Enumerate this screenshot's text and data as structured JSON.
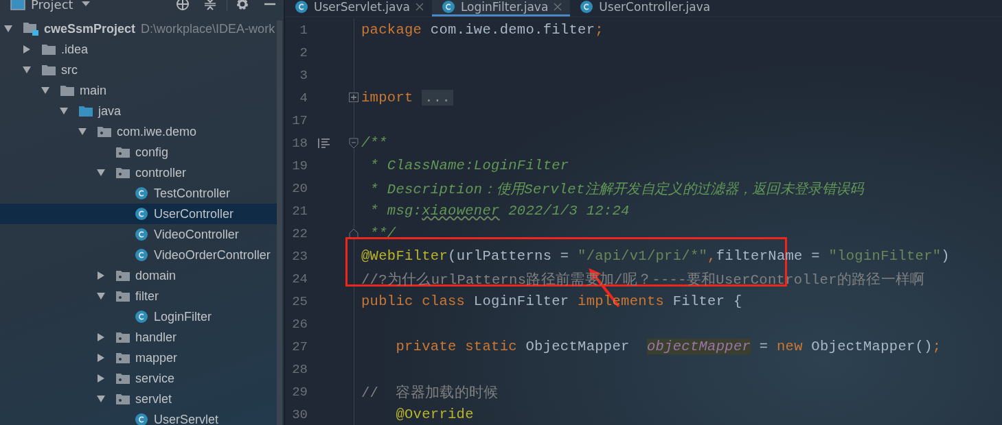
{
  "project_panel": {
    "title": "Project"
  },
  "tree": [
    {
      "label": "cweSsmProject",
      "path": "D:\\workplace\\IDEA-work",
      "kind": "module",
      "expanded": true,
      "selected": false,
      "children": [
        {
          "label": ".idea",
          "kind": "folder",
          "expanded": false,
          "selected": false
        },
        {
          "label": "src",
          "kind": "folder",
          "expanded": true,
          "selected": false,
          "children": [
            {
              "label": "main",
              "kind": "folder",
              "expanded": true,
              "selected": false,
              "children": [
                {
                  "label": "java",
                  "kind": "source",
                  "expanded": true,
                  "selected": false,
                  "children": [
                    {
                      "label": "com.iwe.demo",
                      "kind": "package",
                      "expanded": true,
                      "selected": false,
                      "children": [
                        {
                          "label": "config",
                          "kind": "package",
                          "selected": false
                        },
                        {
                          "label": "controller",
                          "kind": "package",
                          "expanded": true,
                          "selected": false,
                          "children": [
                            {
                              "label": "TestController",
                              "kind": "class",
                              "selected": false
                            },
                            {
                              "label": "UserController",
                              "kind": "class",
                              "selected": true
                            },
                            {
                              "label": "VideoController",
                              "kind": "class",
                              "selected": false
                            },
                            {
                              "label": "VideoOrderController",
                              "kind": "class",
                              "selected": false
                            }
                          ]
                        },
                        {
                          "label": "domain",
                          "kind": "package",
                          "expanded": false,
                          "selected": false
                        },
                        {
                          "label": "filter",
                          "kind": "package",
                          "expanded": true,
                          "selected": false,
                          "children": [
                            {
                              "label": "LoginFilter",
                              "kind": "class",
                              "selected": false
                            }
                          ]
                        },
                        {
                          "label": "handler",
                          "kind": "package",
                          "expanded": false,
                          "selected": false
                        },
                        {
                          "label": "mapper",
                          "kind": "package",
                          "expanded": false,
                          "selected": false
                        },
                        {
                          "label": "service",
                          "kind": "package",
                          "expanded": false,
                          "selected": false
                        },
                        {
                          "label": "servlet",
                          "kind": "package",
                          "expanded": true,
                          "selected": false,
                          "children": [
                            {
                              "label": "UserServlet",
                              "kind": "class",
                              "selected": false
                            }
                          ]
                        }
                      ]
                    }
                  ]
                }
              ]
            }
          ]
        }
      ]
    }
  ],
  "tabs": [
    {
      "label": "UserServlet.java",
      "selected": false,
      "closable": true
    },
    {
      "label": "LoginFilter.java",
      "selected": true,
      "closable": true
    },
    {
      "label": "UserController.java",
      "selected": false,
      "closable": false
    }
  ],
  "code": [
    {
      "number": "1",
      "tokens": [
        {
          "kind": "keyword",
          "text": "package "
        },
        {
          "kind": "plain",
          "text": "com.iwe.demo.filter"
        },
        {
          "kind": "keyword",
          "text": ";"
        }
      ]
    },
    {
      "number": "2"
    },
    {
      "number": "3"
    },
    {
      "number": "4",
      "fold": {
        "kind": "collapsed"
      },
      "tokens": [
        {
          "kind": "keyword",
          "text": "import "
        },
        {
          "kind": "folded",
          "text": "..."
        }
      ]
    },
    {
      "number": "17"
    },
    {
      "number": "18",
      "fold": {
        "kind": "start"
      },
      "doc_toggle": true,
      "tokens": [
        {
          "kind": "doc",
          "text": "/**"
        }
      ]
    },
    {
      "number": "19",
      "tokens": [
        {
          "kind": "doc",
          "text": " * ClassName:LoginFilter"
        }
      ]
    },
    {
      "number": "20",
      "tokens": [
        {
          "kind": "doc",
          "text": " * Description：使用Servlet注解开发自定义的过滤器，返回未登录错误码"
        }
      ]
    },
    {
      "number": "21",
      "tokens": [
        {
          "kind": "doc",
          "text": " * msg:"
        },
        {
          "kind": "typo",
          "text": "xiaowener"
        },
        {
          "kind": "doc",
          "text": " 2022/1/3 12:24"
        }
      ]
    },
    {
      "number": "22",
      "fold": {
        "kind": "end"
      },
      "tokens": [
        {
          "kind": "doc",
          "text": " **/"
        }
      ]
    },
    {
      "number": "23",
      "tokens": [
        {
          "kind": "annotation",
          "text": "@WebFilter"
        },
        {
          "kind": "plain",
          "text": "(urlPatterns = "
        },
        {
          "kind": "string",
          "text": "\"/api/v1/pri/*\""
        },
        {
          "kind": "keyword",
          "text": ","
        },
        {
          "kind": "plain",
          "text": "filterName = "
        },
        {
          "kind": "string",
          "text": "\"loginFilter\""
        },
        {
          "kind": "plain",
          "text": ")"
        }
      ]
    },
    {
      "number": "24",
      "tokens": [
        {
          "kind": "comment",
          "text": "//?为什么urlPatterns路径前需要加/呢？----要和UserController的路径一样啊"
        }
      ]
    },
    {
      "number": "25",
      "tokens": [
        {
          "kind": "keyword",
          "text": "public class "
        },
        {
          "kind": "plain",
          "text": "LoginFilter "
        },
        {
          "kind": "keyword",
          "text": "implements "
        },
        {
          "kind": "plain",
          "text": "Filter {"
        }
      ]
    },
    {
      "number": "26"
    },
    {
      "number": "27",
      "tokens": [
        {
          "kind": "keyword",
          "text": "    private static "
        },
        {
          "kind": "plain",
          "text": "ObjectMapper  "
        },
        {
          "kind": "field",
          "text": "objectMapper"
        },
        {
          "kind": "plain",
          "text": " = "
        },
        {
          "kind": "keyword",
          "text": "new "
        },
        {
          "kind": "plain",
          "text": "ObjectMapper()"
        },
        {
          "kind": "keyword",
          "text": ";"
        }
      ]
    },
    {
      "number": "28"
    },
    {
      "number": "29",
      "tokens": [
        {
          "kind": "comment",
          "text": "//  容器加载的时候"
        }
      ]
    },
    {
      "number": "30",
      "tokens": [
        {
          "kind": "annotation",
          "text": "    @Override"
        }
      ]
    }
  ]
}
